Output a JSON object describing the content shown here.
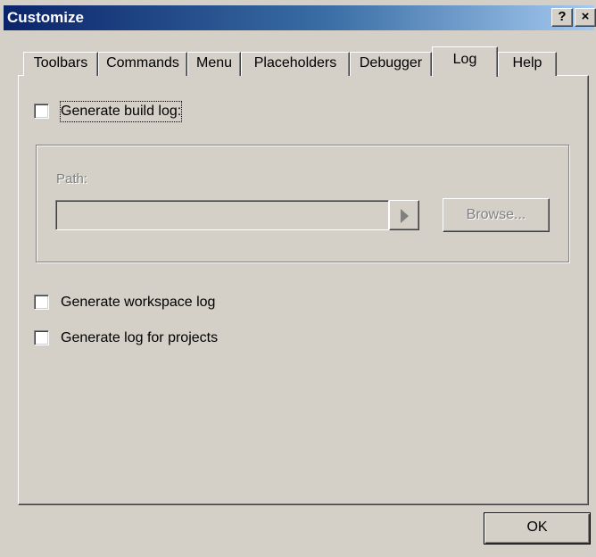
{
  "window": {
    "title": "Customize",
    "help_glyph": "?",
    "close_glyph": "×"
  },
  "tabs": [
    {
      "label": "Toolbars"
    },
    {
      "label": "Commands"
    },
    {
      "label": "Menu"
    },
    {
      "label": "Placeholders"
    },
    {
      "label": "Debugger"
    },
    {
      "label": "Log"
    },
    {
      "label": "Help"
    }
  ],
  "active_tab": "Log",
  "log": {
    "generate_build_log": {
      "label": "Generate build log:",
      "checked": false
    },
    "path": {
      "label": "Path:",
      "value": "",
      "enabled": false
    },
    "browse_button": "Browse...",
    "generate_workspace_log": {
      "label": "Generate workspace log",
      "checked": false
    },
    "generate_log_for_projects": {
      "label": "Generate log for projects",
      "checked": false
    }
  },
  "footer": {
    "ok_label": "OK"
  },
  "colors": {
    "face": "#d4d0c8",
    "title_start": "#0a246a",
    "title_end": "#a6caf0",
    "disabled_text": "#808080"
  }
}
